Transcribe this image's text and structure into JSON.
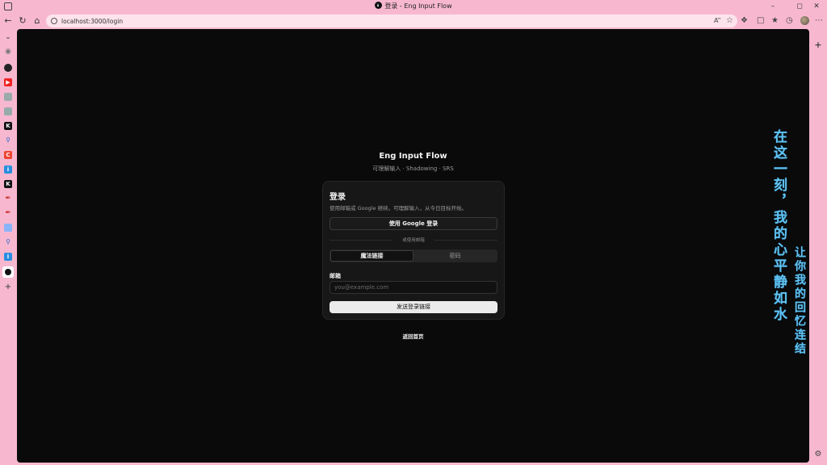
{
  "window": {
    "title": "登录 - Eng Input Flow"
  },
  "browser": {
    "url": "localhost:3000/login"
  },
  "sidebar": {
    "items": [
      {
        "icon": "chevron-down-icon"
      },
      {
        "icon": "globe-icon"
      },
      {
        "icon": "github-icon"
      },
      {
        "icon": "youtube-icon"
      },
      {
        "icon": "site-icon"
      },
      {
        "icon": "site-icon"
      },
      {
        "icon": "k-icon"
      },
      {
        "icon": "search-icon"
      },
      {
        "icon": "c-icon"
      },
      {
        "icon": "translate-icon"
      },
      {
        "icon": "k-icon"
      },
      {
        "icon": "pen-icon"
      },
      {
        "icon": "pen-icon"
      },
      {
        "icon": "document-icon"
      },
      {
        "icon": "search-icon"
      },
      {
        "icon": "translate-icon"
      },
      {
        "icon": "eng-input-flow-icon"
      },
      {
        "icon": "plus-icon"
      }
    ]
  },
  "page": {
    "app_title": "Eng Input Flow",
    "app_subtitle": "可理解输入 · Shadowing · SRS",
    "card": {
      "title": "登录",
      "description": "使用邮箱或 Google 继续。可理解输入，从今日目标开始。",
      "google_button": "使用 Google 登录",
      "divider": "或使用邮箱",
      "tabs": [
        "魔法链接",
        "密码"
      ],
      "email_label": "邮箱",
      "email_placeholder": "you@example.com",
      "submit_button": "发送登录链接"
    },
    "back_link": "返回首页"
  },
  "overlay": {
    "line1": "在这一刻，我的心平静如水",
    "line2": "让你我的回忆连结"
  }
}
